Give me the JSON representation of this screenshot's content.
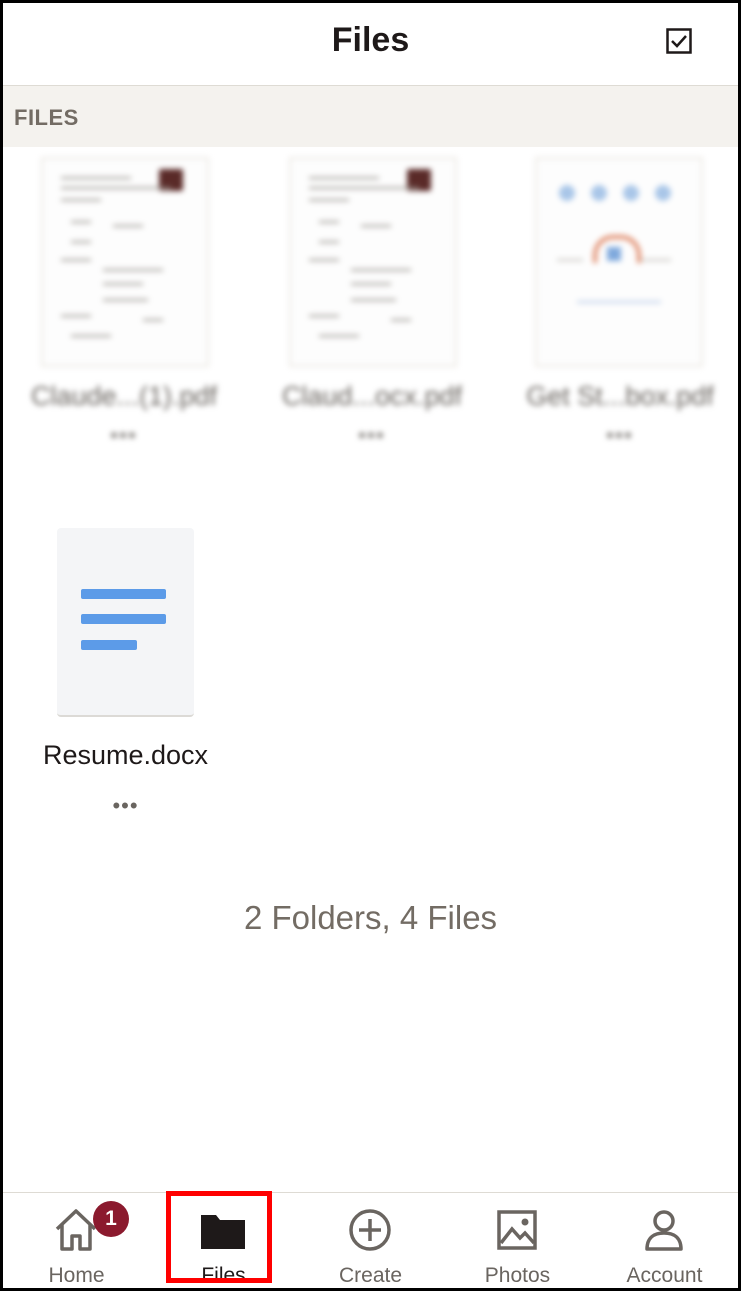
{
  "header": {
    "title": "Files",
    "select_icon": "checkbox-icon"
  },
  "section": {
    "label": "FILES"
  },
  "blurred_files": [
    {
      "name": "Claude...(1).pdf",
      "more": "•••"
    },
    {
      "name": "Claud...ocx.pdf",
      "more": "•••"
    },
    {
      "name": "Get St...box.pdf",
      "more": "•••"
    }
  ],
  "file": {
    "name": "Resume.docx",
    "more": "•••",
    "icon": "document-icon"
  },
  "summary": "2 Folders, 4 Files",
  "tabs": [
    {
      "label": "Home",
      "icon": "home-icon",
      "badge": "1"
    },
    {
      "label": "Files",
      "icon": "folder-icon",
      "active": true
    },
    {
      "label": "Create",
      "icon": "plus-circle-icon"
    },
    {
      "label": "Photos",
      "icon": "image-icon"
    },
    {
      "label": "Account",
      "icon": "person-icon"
    }
  ],
  "colors": {
    "accent_blue": "#5c9be8",
    "badge": "#8b1a2e",
    "highlight": "#ff0000",
    "section_bg": "#f4f2ee"
  }
}
